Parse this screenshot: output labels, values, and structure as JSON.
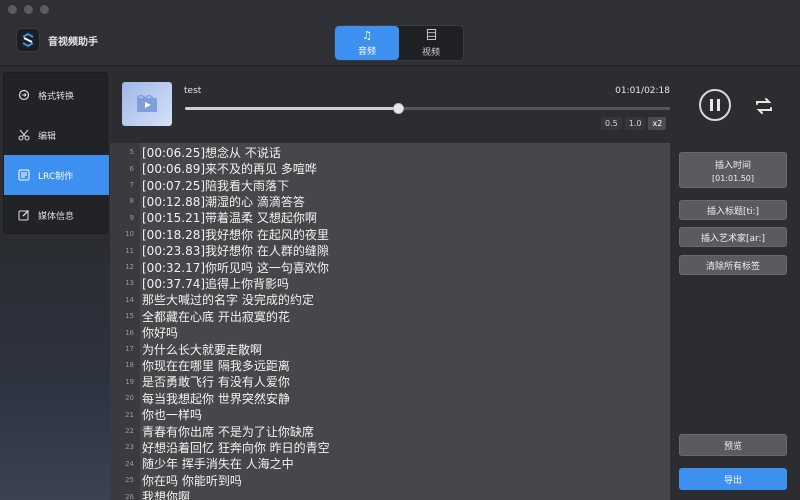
{
  "app": {
    "title": "音视频助手",
    "modes": [
      {
        "label": "音频",
        "icon": "music-note-icon",
        "active": true
      },
      {
        "label": "视频",
        "icon": "film-icon",
        "active": false
      }
    ]
  },
  "sidebar": {
    "items": [
      {
        "label": "格式转换",
        "icon": "convert-icon",
        "active": false
      },
      {
        "label": "编辑",
        "icon": "scissors-icon",
        "active": false
      },
      {
        "label": "LRC制作",
        "icon": "lyrics-icon",
        "active": true
      },
      {
        "label": "媒体信息",
        "icon": "edit-info-icon",
        "active": false
      }
    ]
  },
  "player": {
    "track_name": "test",
    "time": "01:01/02:18",
    "progress": 0.44,
    "speeds": [
      {
        "label": "0.5",
        "active": false
      },
      {
        "label": "1.0",
        "active": false
      },
      {
        "label": "x2",
        "active": true
      }
    ]
  },
  "editor": {
    "lines": [
      {
        "n": "5",
        "text": "[00:06.25]想念从 不说话"
      },
      {
        "n": "6",
        "text": "[00:06.89]来不及的再见 多喧哗"
      },
      {
        "n": "7",
        "text": "[00:07.25]陪我看大雨落下"
      },
      {
        "n": "8",
        "text": "[00:12.88]潮湿的心 滴滴答答"
      },
      {
        "n": "9",
        "text": "[00:15.21]带着温柔 又想起你啊"
      },
      {
        "n": "10",
        "text": "[00:18.28]我好想你 在起风的夜里"
      },
      {
        "n": "11",
        "text": "[00:23.83]我好想你 在人群的缝隙"
      },
      {
        "n": "12",
        "text": "[00:32.17]你听见吗 这一句喜欢你"
      },
      {
        "n": "13",
        "text": "[00:37.74]追得上你背影吗"
      },
      {
        "n": "14",
        "text": "那些大喊过的名字 没完成的约定"
      },
      {
        "n": "15",
        "text": "全都藏在心底 开出寂寞的花"
      },
      {
        "n": "16",
        "text": "你好吗"
      },
      {
        "n": "17",
        "text": "为什么长大就要走散啊"
      },
      {
        "n": "18",
        "text": "你现在在哪里 隔我多远距离"
      },
      {
        "n": "19",
        "text": "是否勇敢飞行 有没有人爱你"
      },
      {
        "n": "20",
        "text": "每当我想起你 世界突然安静"
      },
      {
        "n": "21",
        "text": "你也一样吗"
      },
      {
        "n": "22",
        "text": "青春有你出席 不是为了让你缺席"
      },
      {
        "n": "23",
        "text": "好想沿着回忆 狂奔向你 昨日的青空"
      },
      {
        "n": "24",
        "text": "随少年 挥手消失在 人海之中"
      },
      {
        "n": "25",
        "text": "你在吗 你能听到吗"
      },
      {
        "n": "26",
        "text": "我想你啊"
      }
    ]
  },
  "actions": {
    "insert_time": "插入时间",
    "insert_time_value": "[01:01.50]",
    "insert_title": "插入标题[ti:]",
    "insert_artist": "插入艺术家[ar:]",
    "clear_tags": "清除所有标签",
    "preview": "预览",
    "export": "导出"
  },
  "colors": {
    "accent": "#3d8ff0",
    "background": "#2b2d31",
    "editor_bg": "#46474b"
  }
}
